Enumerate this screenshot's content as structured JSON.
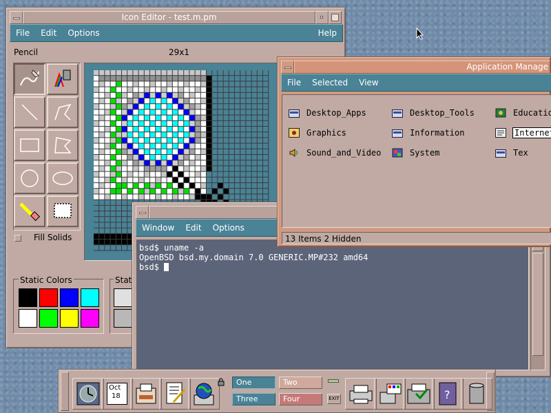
{
  "icon_editor": {
    "title": "Icon Editor - test.m.pm",
    "menu": {
      "file": "File",
      "edit": "Edit",
      "options": "Options",
      "help": "Help"
    },
    "tool_name": "Pencil",
    "coords": "29x1",
    "fill_solids_label": "Fill Solids",
    "static_colors_label": "Static Colors",
    "static_grays_label": "Stati",
    "colors": [
      "#000000",
      "#ff0000",
      "#0000ff",
      "#00ffff",
      "#ffffff",
      "#00ff00",
      "#ffff00",
      "#ff00ff"
    ]
  },
  "app_manager": {
    "title": "Application Manage",
    "menu": {
      "file": "File",
      "selected": "Selected",
      "view": "View"
    },
    "items": [
      {
        "label": "Desktop_Apps",
        "icon": "folder-icon"
      },
      {
        "label": "Desktop_Tools",
        "icon": "folder-icon"
      },
      {
        "label": "Educatio",
        "icon": "education-icon"
      },
      {
        "label": "Graphics",
        "icon": "graphics-icon"
      },
      {
        "label": "Information",
        "icon": "folder-icon"
      },
      {
        "label": "Internet",
        "icon": "internet-icon"
      },
      {
        "label": "Sound_and_Video",
        "icon": "speaker-icon"
      },
      {
        "label": "System",
        "icon": "system-icon"
      },
      {
        "label": "Tex",
        "icon": "folder-icon"
      }
    ],
    "status": "13 Items 2 Hidden"
  },
  "terminal": {
    "menu": {
      "window": "Window",
      "edit": "Edit",
      "options": "Options"
    },
    "lines": [
      "bsd$ uname -a",
      "OpenBSD bsd.my.domain 7.0 GENERIC.MP#232 amd64",
      "bsd$ "
    ]
  },
  "front_panel": {
    "calendar_month": "Oct",
    "calendar_day": "18",
    "workspaces": [
      "One",
      "Two",
      "Three",
      "Four"
    ],
    "exit_label": "EXIT"
  },
  "colors": {
    "desktop": "#6e8aa8",
    "window_bg": "#c0aaa3",
    "menubar": "#4a8296",
    "active_frame": "#cf9a82",
    "terminal_bg": "#5c6479"
  }
}
